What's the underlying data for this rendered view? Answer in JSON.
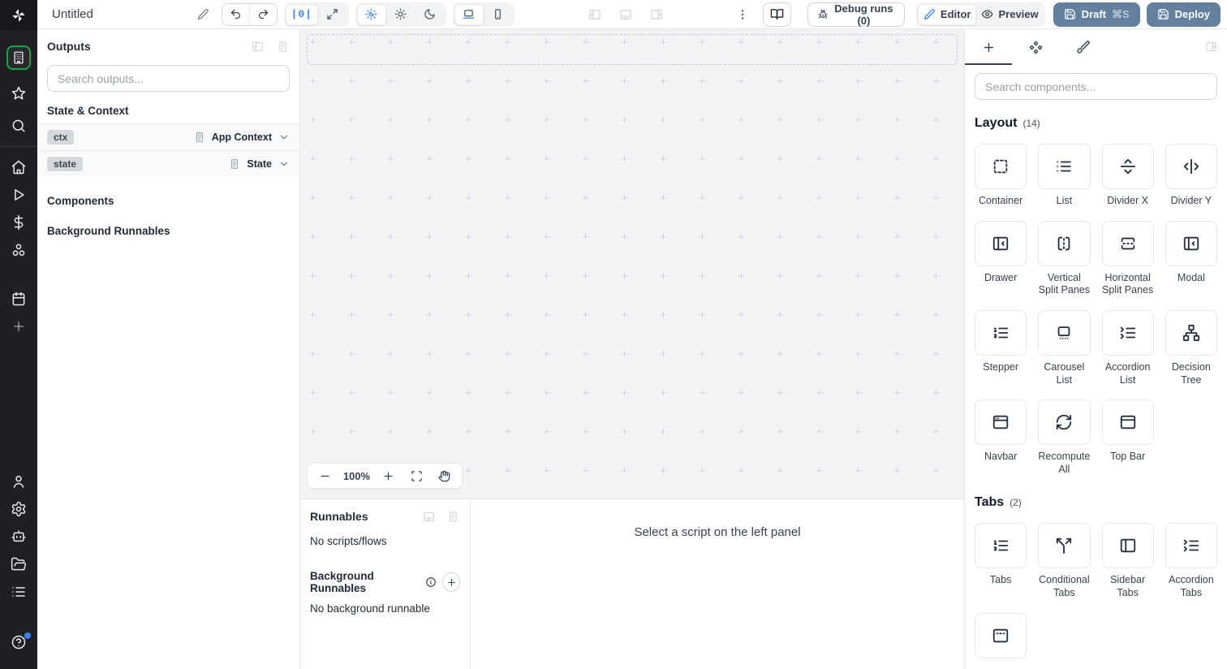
{
  "colors": {
    "accent_blue": "#3b82f6",
    "steel_blue_button": "#64809f",
    "active_green": "#16a34a"
  },
  "topbar": {
    "title": "Untitled",
    "zoom_reset_label": "|0|",
    "debug_runs_label": "Debug runs (0)",
    "editor_label": "Editor",
    "preview_label": "Preview",
    "draft_label": "Draft",
    "draft_shortcut": "⌘S",
    "deploy_label": "Deploy"
  },
  "left_panel": {
    "title": "Outputs",
    "search_placeholder": "Search outputs...",
    "state_context_header": "State & Context",
    "components_header": "Components",
    "background_runnables_header": "Background Runnables",
    "rows": [
      {
        "badge": "ctx",
        "name": "App Context"
      },
      {
        "badge": "state",
        "name": "State"
      }
    ]
  },
  "canvas": {
    "zoom_label": "100%"
  },
  "bottom_panel": {
    "runnables_title": "Runnables",
    "no_scripts_text": "No scripts/flows",
    "background_runnables_title": "Background Runnables",
    "no_background_text": "No background runnable",
    "select_hint": "Select a script on the left panel"
  },
  "right_panel": {
    "search_placeholder": "Search components...",
    "sections": [
      {
        "title": "Layout",
        "count": "(14)",
        "items": [
          {
            "label": "Container",
            "icon": "container"
          },
          {
            "label": "List",
            "icon": "list"
          },
          {
            "label": "Divider X",
            "icon": "divider-x"
          },
          {
            "label": "Divider Y",
            "icon": "divider-y"
          },
          {
            "label": "Drawer",
            "icon": "drawer"
          },
          {
            "label": "Vertical Split Panes",
            "icon": "vsplit"
          },
          {
            "label": "Horizontal Split Panes",
            "icon": "hsplit"
          },
          {
            "label": "Modal",
            "icon": "modal"
          },
          {
            "label": "Stepper",
            "icon": "list-ordered"
          },
          {
            "label": "Carousel List",
            "icon": "carousel"
          },
          {
            "label": "Accordion List",
            "icon": "list-collapse"
          },
          {
            "label": "Decision Tree",
            "icon": "network"
          },
          {
            "label": "Navbar",
            "icon": "app-window"
          },
          {
            "label": "Recompute All",
            "icon": "refresh"
          },
          {
            "label": "Top Bar",
            "icon": "panel-top"
          }
        ]
      },
      {
        "title": "Tabs",
        "count": "(2)",
        "items": [
          {
            "label": "Tabs",
            "icon": "list-ordered"
          },
          {
            "label": "Conditional Tabs",
            "icon": "split"
          },
          {
            "label": "Sidebar Tabs",
            "icon": "panel-left"
          },
          {
            "label": "Accordion Tabs",
            "icon": "list-collapse"
          },
          {
            "label": "",
            "icon": "panel-top-dashed"
          }
        ]
      }
    ]
  }
}
